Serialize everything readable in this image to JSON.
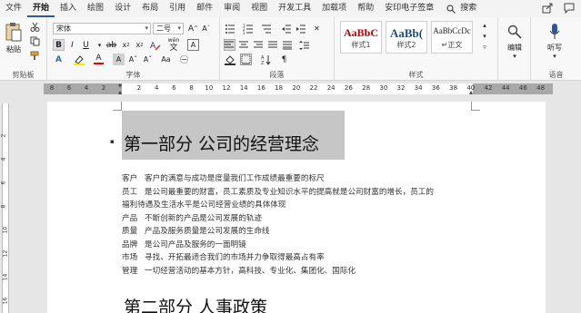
{
  "menu": {
    "tabs": [
      "文件",
      "开始",
      "插入",
      "绘图",
      "设计",
      "布局",
      "引用",
      "邮件",
      "审阅",
      "视图",
      "开发工具",
      "加载项",
      "帮助",
      "安印电子签章"
    ],
    "active_index": 1,
    "search_label": "搜索"
  },
  "ribbon": {
    "clipboard": {
      "paste_label": "粘贴",
      "group_label": "剪贴板"
    },
    "font": {
      "font_name": "宋体",
      "font_size": "二号",
      "wen": "wén",
      "group_label": "字体"
    },
    "paragraph": {
      "group_label": "段落"
    },
    "styles": {
      "items": [
        {
          "sample": "AaBbC",
          "name": "样式1"
        },
        {
          "sample": "AaBb(",
          "name": "样式2"
        },
        {
          "sample": "AaBbCcDc",
          "name": "↵正文"
        }
      ],
      "group_label": "样式"
    },
    "editing": {
      "label": "编辑"
    },
    "voice": {
      "dictate_label": "听写",
      "group_label": "语音"
    }
  },
  "ruler": {
    "numbers": [
      "8",
      "6",
      "4",
      "2",
      "2",
      "4",
      "6",
      "8",
      "10",
      "12",
      "14",
      "16",
      "18",
      "20",
      "22",
      "24",
      "26",
      "28",
      "30",
      "32",
      "34",
      "36",
      "38",
      "40",
      "42",
      "44",
      "46",
      "48"
    ]
  },
  "vruler": {
    "numbers": [
      "2",
      "4",
      "6",
      "8",
      "10",
      "12",
      "14",
      "16"
    ]
  },
  "document": {
    "heading1": "第一部分  公司的经营理念",
    "lines": [
      {
        "key": "客户",
        "text": "客户的满意与成功是度量我们工作成绩最重要的标尺"
      },
      {
        "key": "员工",
        "text": "是公司最重要的财富，员工素质及专业知识水平的提高就是公司财富的增长，员工的"
      },
      {
        "key": "",
        "text": "福利待遇及生活水平是公司经营业绩的具体体现"
      },
      {
        "key": "产品",
        "text": "不断创新的产品是公司发展的轨迹"
      },
      {
        "key": "质量",
        "text": "产品及服务质量是公司发展的生命线"
      },
      {
        "key": "品牌",
        "text": "是公司产品及服务的一面明镜"
      },
      {
        "key": "市场",
        "text": "寻找、开拓最适合我们的市场并力争取得最高占有率"
      },
      {
        "key": "管理",
        "text": "一切经营活动的基本方针，高科技、专业化、集团化、国际化"
      }
    ],
    "heading2": "第二部分  人事政策"
  },
  "colors": {
    "accent": "#2b579a",
    "selection": "#c6c6c6"
  }
}
